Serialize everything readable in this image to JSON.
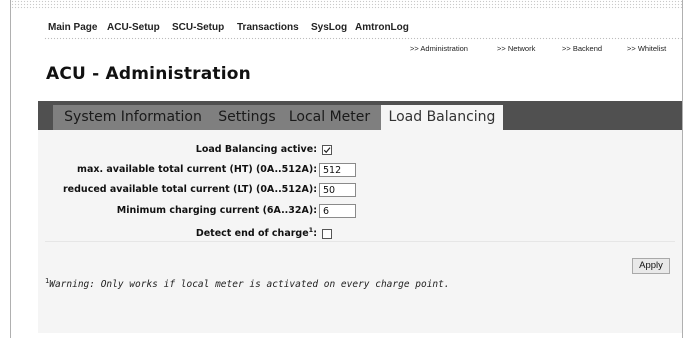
{
  "top_nav": [
    "Main Page",
    "ACU-Setup",
    "SCU-Setup",
    "Transactions",
    "SysLog",
    "AmtronLog"
  ],
  "sub_nav": [
    ">> Administration",
    ">> Network",
    ">> Backend",
    ">> Whitelist"
  ],
  "page_title": "ACU - Administration",
  "tabs": [
    "System Information",
    "Settings",
    "Local Meter",
    "Load Balancing"
  ],
  "active_tab": "Load Balancing",
  "form": {
    "load_balancing_active": {
      "label": "Load Balancing active:",
      "checked": true
    },
    "max_current": {
      "label": "max. available total current (HT) (0A..512A):",
      "value": "512"
    },
    "reduced_current": {
      "label": "reduced available total current (LT) (0A..512A):",
      "value": "50"
    },
    "min_charging": {
      "label": "Minimum charging current (6A..32A):",
      "value": "6"
    },
    "detect_end": {
      "label": "Detect end of charge",
      "label_sup": "1",
      "label_suffix": ":",
      "checked": false
    }
  },
  "apply_label": "Apply",
  "warning": {
    "sup": "1",
    "text": "Warning: Only works if local meter is activated on every charge point."
  },
  "colors": {
    "tabbar": "#505050",
    "tab": "#7f7f7f",
    "active_tab": "#f5f5f5",
    "panel": "#f5f5f5"
  }
}
